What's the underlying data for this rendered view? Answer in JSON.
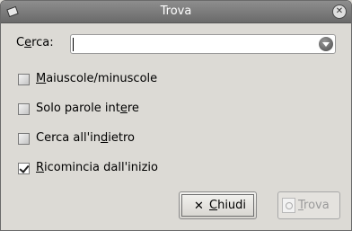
{
  "window": {
    "title": "Trova"
  },
  "search": {
    "label_before": "C",
    "label_mnemonic": "e",
    "label_after": "rca:",
    "value": "",
    "placeholder": ""
  },
  "options": [
    {
      "before": "",
      "mnemonic": "M",
      "after": "aiuscole/minuscole",
      "checked": false
    },
    {
      "before": "Solo parole int",
      "mnemonic": "e",
      "after": "re",
      "checked": false
    },
    {
      "before": "Cerca all'in",
      "mnemonic": "d",
      "after": "ietro",
      "checked": false
    },
    {
      "before": "",
      "mnemonic": "R",
      "after": "icomincia dall'inizio",
      "checked": true
    }
  ],
  "buttons": {
    "close": {
      "mnemonic": "C",
      "rest": "hiudi",
      "icon": "close-x-icon"
    },
    "find": {
      "mnemonic": "T",
      "rest": "rova",
      "icon": "find-icon",
      "enabled": false
    }
  }
}
